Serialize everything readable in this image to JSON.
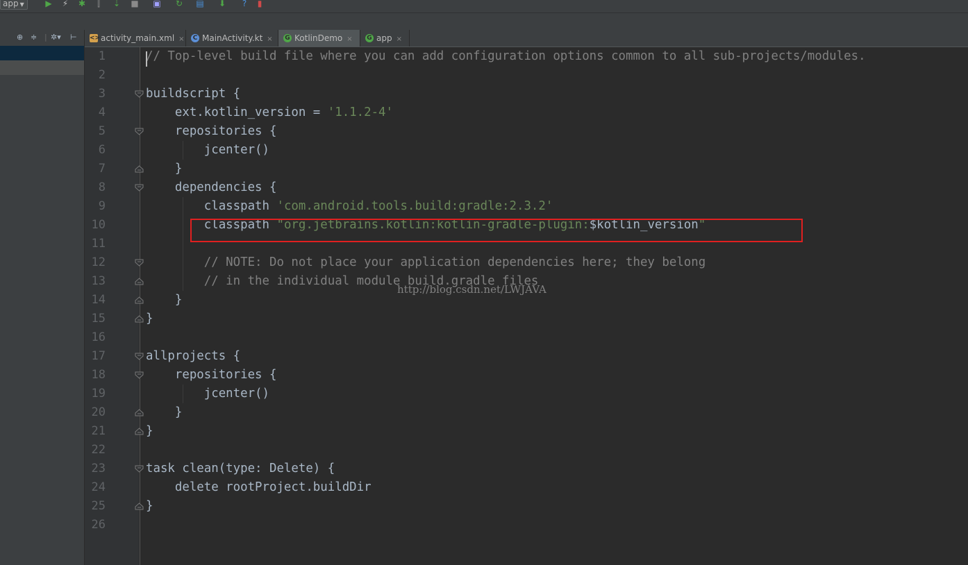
{
  "toolbar": {
    "config_label": "app"
  },
  "sidebar": {
    "tool_icons": [
      "target-icon",
      "collapse-icon",
      "gear-icon",
      "pin-icon"
    ]
  },
  "tabs": [
    {
      "label": "activity_main.xml",
      "icon": "xml-file-icon",
      "icon_color": "#d4a04c",
      "active": false
    },
    {
      "label": "MainActivity.kt",
      "icon": "kotlin-class-icon",
      "icon_color": "#5c8fd6",
      "active": false
    },
    {
      "label": "KotlinDemo",
      "icon": "gradle-icon",
      "icon_color": "#4fa648",
      "active": true
    },
    {
      "label": "app",
      "icon": "gradle-icon",
      "icon_color": "#4fa648",
      "active": false
    }
  ],
  "editor": {
    "lines": [
      {
        "n": "1",
        "parts": [
          {
            "t": "// Top-level build file where you can add configuration options common to all sub-projects/modules.",
            "k": "c"
          }
        ]
      },
      {
        "n": "2",
        "parts": []
      },
      {
        "n": "3",
        "parts": [
          {
            "t": "buildscript {",
            "k": "p"
          }
        ]
      },
      {
        "n": "4",
        "parts": [
          {
            "t": "    ext.kotlin_version = ",
            "k": "p"
          },
          {
            "t": "'1.1.2-4'",
            "k": "s"
          }
        ]
      },
      {
        "n": "5",
        "parts": [
          {
            "t": "    repositories {",
            "k": "p"
          }
        ]
      },
      {
        "n": "6",
        "parts": [
          {
            "t": "        jcenter()",
            "k": "p"
          }
        ]
      },
      {
        "n": "7",
        "parts": [
          {
            "t": "    }",
            "k": "p"
          }
        ]
      },
      {
        "n": "8",
        "parts": [
          {
            "t": "    dependencies {",
            "k": "p"
          }
        ]
      },
      {
        "n": "9",
        "parts": [
          {
            "t": "        classpath ",
            "k": "p"
          },
          {
            "t": "'com.android.tools.build:gradle:2.3.2'",
            "k": "s"
          }
        ]
      },
      {
        "n": "10",
        "parts": [
          {
            "t": "        classpath ",
            "k": "p"
          },
          {
            "t": "\"org.jetbrains.kotlin:kotlin-gradle-plugin:",
            "k": "s"
          },
          {
            "t": "$kotlin_version",
            "k": "p"
          },
          {
            "t": "\"",
            "k": "s"
          }
        ]
      },
      {
        "n": "11",
        "parts": []
      },
      {
        "n": "12",
        "parts": [
          {
            "t": "        // NOTE: Do not place your application dependencies here; they belong",
            "k": "c"
          }
        ]
      },
      {
        "n": "13",
        "parts": [
          {
            "t": "        // in the individual module build.gradle files",
            "k": "c"
          }
        ]
      },
      {
        "n": "14",
        "parts": [
          {
            "t": "    }",
            "k": "p"
          }
        ]
      },
      {
        "n": "15",
        "parts": [
          {
            "t": "}",
            "k": "p"
          }
        ]
      },
      {
        "n": "16",
        "parts": []
      },
      {
        "n": "17",
        "parts": [
          {
            "t": "allprojects {",
            "k": "p"
          }
        ]
      },
      {
        "n": "18",
        "parts": [
          {
            "t": "    repositories {",
            "k": "p"
          }
        ]
      },
      {
        "n": "19",
        "parts": [
          {
            "t": "        jcenter()",
            "k": "p"
          }
        ]
      },
      {
        "n": "20",
        "parts": [
          {
            "t": "    }",
            "k": "p"
          }
        ]
      },
      {
        "n": "21",
        "parts": [
          {
            "t": "}",
            "k": "p"
          }
        ]
      },
      {
        "n": "22",
        "parts": []
      },
      {
        "n": "23",
        "parts": [
          {
            "t": "task clean(type: Delete) {",
            "k": "p"
          }
        ]
      },
      {
        "n": "24",
        "parts": [
          {
            "t": "    delete rootProject.buildDir",
            "k": "p"
          }
        ]
      },
      {
        "n": "25",
        "parts": [
          {
            "t": "}",
            "k": "p"
          }
        ]
      },
      {
        "n": "26",
        "parts": []
      }
    ],
    "fold_markers": [
      {
        "line": 3,
        "kind": "open"
      },
      {
        "line": 5,
        "kind": "open"
      },
      {
        "line": 7,
        "kind": "close"
      },
      {
        "line": 8,
        "kind": "open"
      },
      {
        "line": 12,
        "kind": "open"
      },
      {
        "line": 13,
        "kind": "close"
      },
      {
        "line": 14,
        "kind": "close"
      },
      {
        "line": 15,
        "kind": "close"
      },
      {
        "line": 17,
        "kind": "open"
      },
      {
        "line": 18,
        "kind": "open"
      },
      {
        "line": 20,
        "kind": "close"
      },
      {
        "line": 21,
        "kind": "close"
      },
      {
        "line": 23,
        "kind": "open"
      },
      {
        "line": 25,
        "kind": "close"
      }
    ]
  },
  "watermark": "http://blog.csdn.net/LWJAVA",
  "colors": {
    "comment": "#808080",
    "string": "#6a8759",
    "plain": "#a9b7c6",
    "highlight_border": "#e02020"
  }
}
